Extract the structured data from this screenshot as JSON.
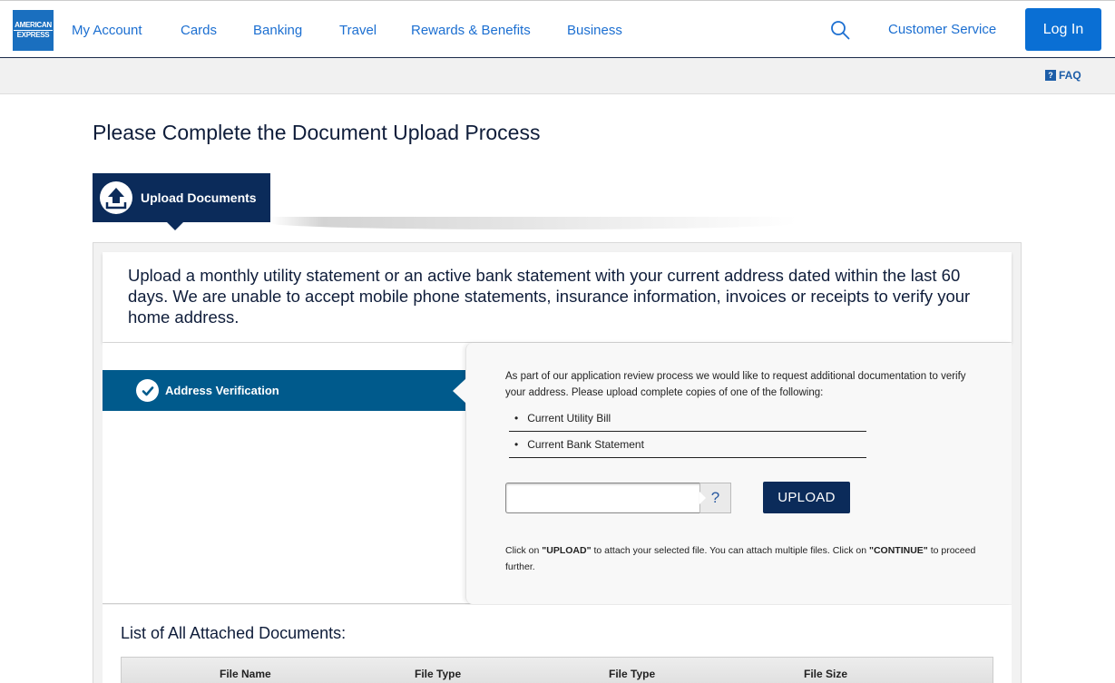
{
  "header": {
    "logo_line1": "AMERICAN",
    "logo_line2": "EXPRESS",
    "nav": [
      "My Account",
      "Cards",
      "Banking",
      "Travel",
      "Rewards & Benefits",
      "Business"
    ],
    "customer_service": "Customer Service",
    "login": "Log In",
    "search_icon": "search-icon"
  },
  "subheader": {
    "faq_icon": "?",
    "faq": "FAQ"
  },
  "page": {
    "title": "Please Complete the Document Upload Process",
    "step_tab": "Upload Documents",
    "instructions": "Upload a monthly utility statement or an active bank statement with your current address dated within the last 60 days. We are unable to accept mobile phone statements, insurance information, invoices or receipts to verify your home address."
  },
  "verification": {
    "section_label": "Address Verification",
    "request_text": "As part of our application review process we would like to request additional documentation to verify your address. Please upload complete copies of one of the following:",
    "documents": [
      "Current Utility Bill",
      "Current Bank Statement"
    ],
    "help_label": "?",
    "upload_label": "UPLOAD",
    "hint_prefix": "Click on ",
    "hint_upload": "\"UPLOAD\"",
    "hint_middle": " to attach your selected file. You can attach multiple files. Click on ",
    "hint_continue": "\"CONTINUE\"",
    "hint_suffix": " to proceed further."
  },
  "attachments": {
    "title": "List of All Attached Documents:",
    "columns": [
      "File Name",
      "File Type",
      "File Type",
      "File Size"
    ]
  },
  "colors": {
    "brand_blue": "#1a6fbf",
    "navy": "#0b2b5a",
    "teal_bar": "#005a8c",
    "link_blue": "#1c6fd1"
  }
}
